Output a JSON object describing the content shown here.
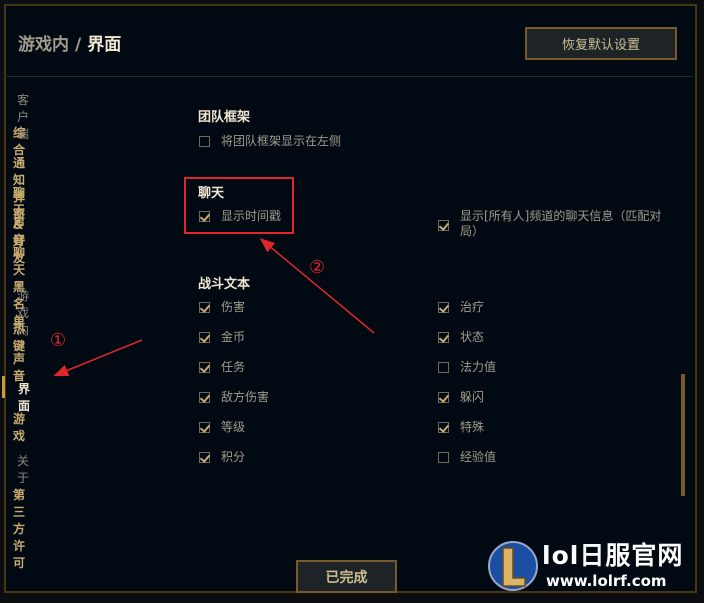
{
  "header": {
    "breadcrumb_root": "游戏内",
    "breadcrumb_sep": "/",
    "breadcrumb_current": "界面",
    "reset_button": "恢复默认设置"
  },
  "sidebar": {
    "group_client": "客户端",
    "client_items": [
      "综合",
      "通知弹窗",
      "聊天&好友",
      "声音",
      "聊天黑名单"
    ],
    "group_ingame": "游戏内",
    "ingame_items": [
      "热键",
      "声音",
      "界面",
      "游戏"
    ],
    "active_item": "界面",
    "group_about": "关于",
    "about_items": [
      "第三方许可"
    ]
  },
  "sections": {
    "team_frame": {
      "title": "团队框架",
      "options": [
        {
          "label": "将团队框架显示在左侧",
          "checked": false
        }
      ]
    },
    "chat": {
      "title": "聊天",
      "options": [
        {
          "label": "显示时间戳",
          "checked": true
        },
        {
          "label": "显示[所有人]频道的聊天信息（匹配对局）",
          "checked": true
        }
      ]
    },
    "combat_text": {
      "title": "战斗文本",
      "left": [
        {
          "label": "伤害",
          "checked": true
        },
        {
          "label": "金币",
          "checked": true
        },
        {
          "label": "任务",
          "checked": true
        },
        {
          "label": "敌方伤害",
          "checked": true
        },
        {
          "label": "等级",
          "checked": true
        },
        {
          "label": "积分",
          "checked": true
        }
      ],
      "right": [
        {
          "label": "治疗",
          "checked": true
        },
        {
          "label": "状态",
          "checked": true
        },
        {
          "label": "法力值",
          "checked": false
        },
        {
          "label": "躲闪",
          "checked": true
        },
        {
          "label": "特殊",
          "checked": true
        },
        {
          "label": "经验值",
          "checked": false
        }
      ]
    }
  },
  "annotations": {
    "marker1": "①",
    "marker2": "②",
    "color": "#e0252b"
  },
  "footer": {
    "done_button": "已完成"
  },
  "watermark": {
    "site_name": "lol日服官网",
    "url": "www.lolrf.com"
  },
  "colors": {
    "accent_gold": "#c8aa6e",
    "frame_gold": "#785a28",
    "background": "#010a13"
  }
}
